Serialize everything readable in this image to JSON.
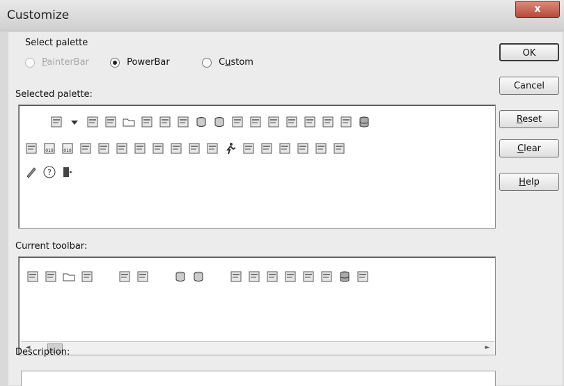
{
  "window": {
    "title": "Customize",
    "close_symbol": "x"
  },
  "select_palette": {
    "label": "Select palette",
    "options": [
      {
        "label": "PainterBar",
        "underline": "P",
        "rest": "ainterBar",
        "state": "disabled"
      },
      {
        "label": "PowerBar",
        "state": "checked"
      },
      {
        "label": "Custom",
        "pre": "C",
        "underline": "u",
        "rest": "stom",
        "state": "unchecked"
      }
    ]
  },
  "selected_palette": {
    "label": "Selected palette:",
    "rows": [
      [
        "new-window-icon",
        "dropdown-arrow-icon",
        "new-icon",
        "tree-view-icon",
        "open-folder-icon",
        "inspect-icon",
        "structure-icon",
        "library-icon",
        "database-icon",
        "database-icon",
        "properties-icon",
        "document-icon",
        "query-icon",
        "report-icon",
        "pipeline-icon",
        "table-icon",
        "datastore-icon",
        "database-stack-icon"
      ],
      [
        "edit-note-icon",
        "binary-010-icon",
        "binary-010-icon",
        "transport-icon",
        "debug-010-icon",
        "connect-icon",
        "profile-icon",
        "export-icon",
        "deploy-icon",
        "bug-icon",
        "bug-stop-icon",
        "run-icon",
        "run-stop-icon",
        "split-view-icon",
        "layout-icon",
        "window-icon",
        "arrange-icon",
        "grid-icon"
      ],
      [
        "pen-icon",
        "help-icon",
        "exit-icon"
      ]
    ]
  },
  "current_toolbar": {
    "label": "Current toolbar:",
    "groups": [
      [
        "new-icon",
        "tree-view-icon",
        "open-folder-icon",
        "inspect-icon"
      ],
      [
        "structure-icon",
        "library-icon"
      ],
      [
        "database-icon",
        "database-icon"
      ],
      [
        "document-icon",
        "query-icon",
        "report-icon",
        "pipeline-icon",
        "table-icon",
        "datastore-icon",
        "database-stack-icon",
        "edit-note-icon"
      ]
    ],
    "scroll_left": "◄",
    "scroll_right": "►"
  },
  "description": {
    "label": "Description:"
  },
  "buttons": {
    "ok": "OK",
    "cancel": "Cancel",
    "reset": {
      "underline": "R",
      "rest": "eset"
    },
    "clear": {
      "underline": "C",
      "rest": "lear"
    },
    "help": {
      "underline": "H",
      "rest": "elp"
    }
  }
}
